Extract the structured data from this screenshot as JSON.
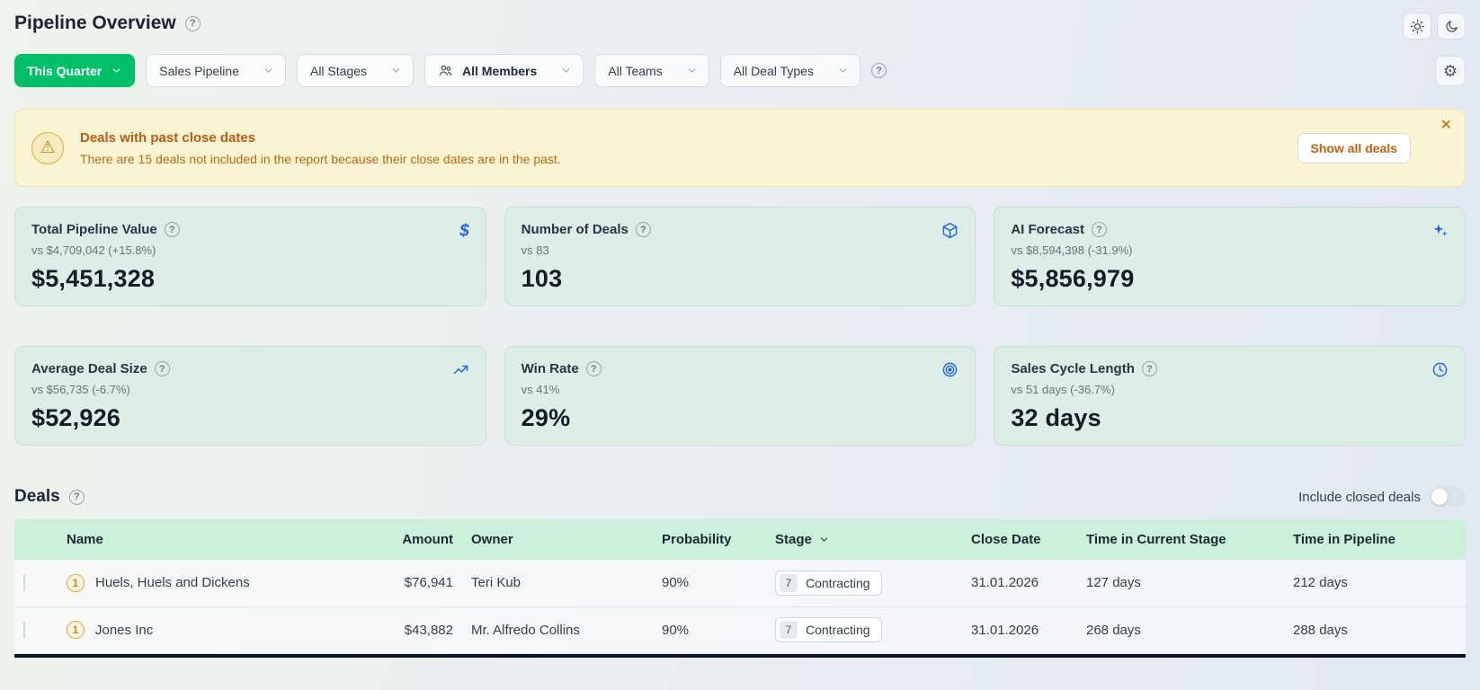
{
  "header": {
    "title": "Pipeline Overview"
  },
  "help_glyph": "?",
  "filters": {
    "time_range": "This Quarter",
    "pipeline": "Sales Pipeline",
    "stages": "All Stages",
    "members": "All Members",
    "teams": "All Teams",
    "deal_types": "All Deal Types"
  },
  "banner": {
    "icon_glyph": "⚠",
    "title": "Deals with past close dates",
    "message": "There are 15 deals not included in the report because their close dates are in the past.",
    "action_label": "Show all deals",
    "close_glyph": "✕"
  },
  "kpis": [
    {
      "label": "Total Pipeline Value",
      "comparison": "vs $4,709,042 (+15.8%)",
      "value": "$5,451,328",
      "icon": "dollar-icon"
    },
    {
      "label": "Number of Deals",
      "comparison": "vs 83",
      "value": "103",
      "icon": "cube-icon"
    },
    {
      "label": "AI Forecast",
      "comparison": "vs $8,594,398 (-31.9%)",
      "value": "$5,856,979",
      "icon": "sparkles-icon"
    },
    {
      "label": "Average Deal Size",
      "comparison": "vs $56,735 (-6.7%)",
      "value": "$52,926",
      "icon": "trend-up-icon"
    },
    {
      "label": "Win Rate",
      "comparison": "vs 41%",
      "value": "29%",
      "icon": "target-icon"
    },
    {
      "label": "Sales Cycle Length",
      "comparison": "vs 51 days (-36.7%)",
      "value": "32 days",
      "icon": "clock-icon"
    }
  ],
  "deals": {
    "title": "Deals",
    "toggle_label": "Include closed deals",
    "columns": [
      "Name",
      "Amount",
      "Owner",
      "Probability",
      "Stage",
      "Close Date",
      "Time in Current Stage",
      "Time in Pipeline"
    ],
    "rows": [
      {
        "badge": "1",
        "name": "Huels, Huels and Dickens",
        "amount": "$76,941",
        "owner": "Teri Kub",
        "probability": "90%",
        "stage_num": "7",
        "stage_name": "Contracting",
        "close_date": "31.01.2026",
        "time_in_stage": "127 days",
        "time_in_pipeline": "212 days"
      },
      {
        "badge": "1",
        "name": "Jones Inc",
        "amount": "$43,882",
        "owner": "Mr. Alfredo Collins",
        "probability": "90%",
        "stage_num": "7",
        "stage_name": "Contracting",
        "close_date": "31.01.2026",
        "time_in_stage": "268 days",
        "time_in_pipeline": "288 days"
      }
    ]
  },
  "colors": {
    "accent_green": "#00c06a",
    "kpi_icon_blue": "#2563eb",
    "banner_text": "#bb5c10"
  },
  "settings_glyph": "⚙"
}
